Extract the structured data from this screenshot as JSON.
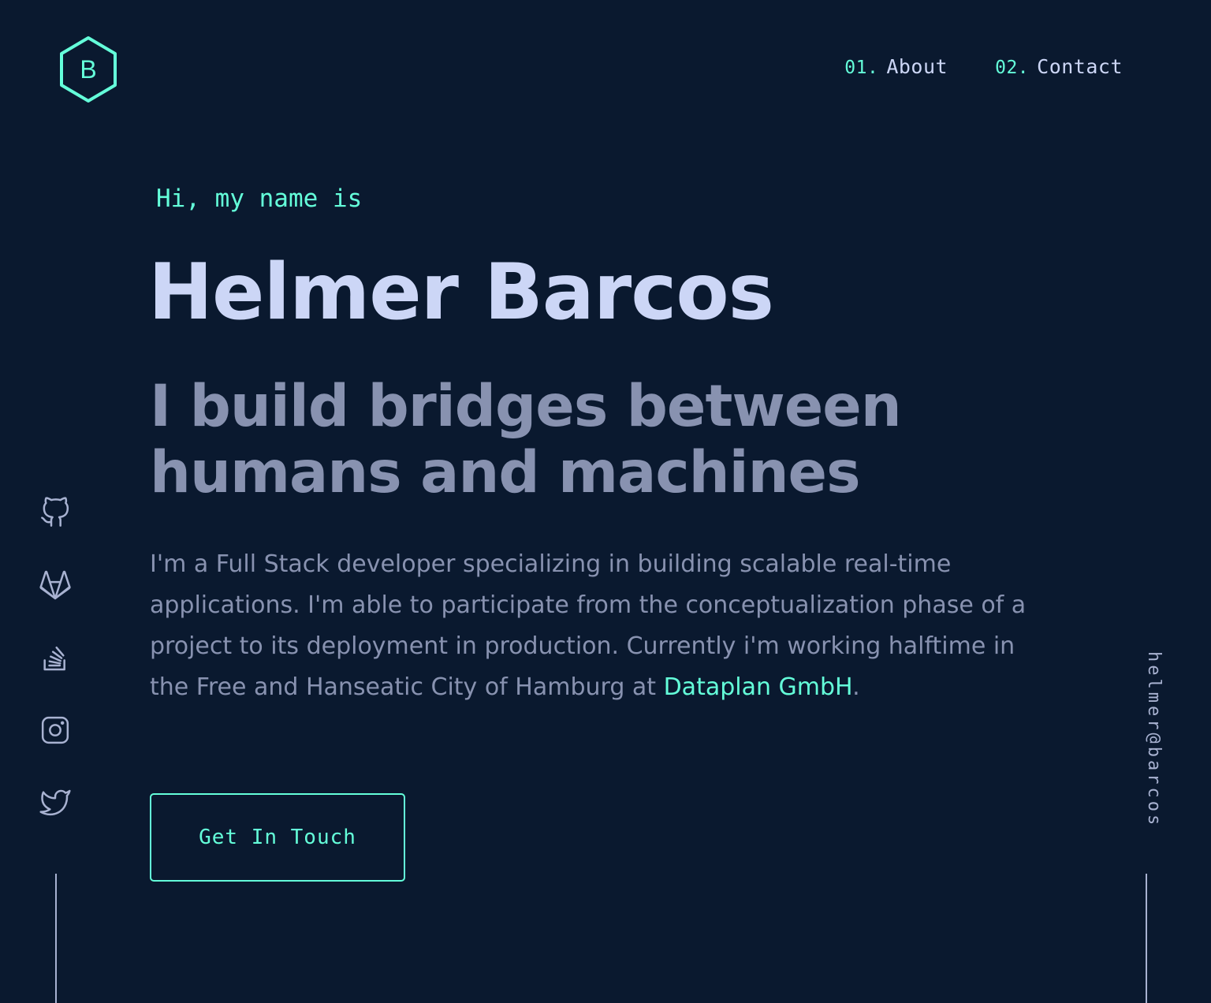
{
  "colors": {
    "background": "#0a192f",
    "accent": "#64ffda",
    "heading": "#ccd6f6",
    "text": "#8892b0"
  },
  "logo": {
    "letter": "B",
    "icon": "hexagon-logo-icon"
  },
  "nav": {
    "items": [
      {
        "number": "01.",
        "label": "About"
      },
      {
        "number": "02.",
        "label": "Contact"
      }
    ]
  },
  "hero": {
    "greeting": "Hi, my name is",
    "name": "Helmer Barcos",
    "tagline": "I build bridges between humans and machines",
    "bio_text": "I'm a Full Stack developer specializing in building scalable real-time applications. I'm able to participate from the conceptualization phase of a project to its deployment in production. Currently i'm working halftime in the Free and Hanseatic City of Hamburg at ",
    "bio_link": "Dataplan GmbH",
    "bio_end": ".",
    "cta_label": "Get In Touch"
  },
  "social": [
    {
      "icon": "github-icon"
    },
    {
      "icon": "gitlab-icon"
    },
    {
      "icon": "stackoverflow-icon"
    },
    {
      "icon": "instagram-icon"
    },
    {
      "icon": "twitter-icon"
    }
  ],
  "email": "helmer@barcos"
}
